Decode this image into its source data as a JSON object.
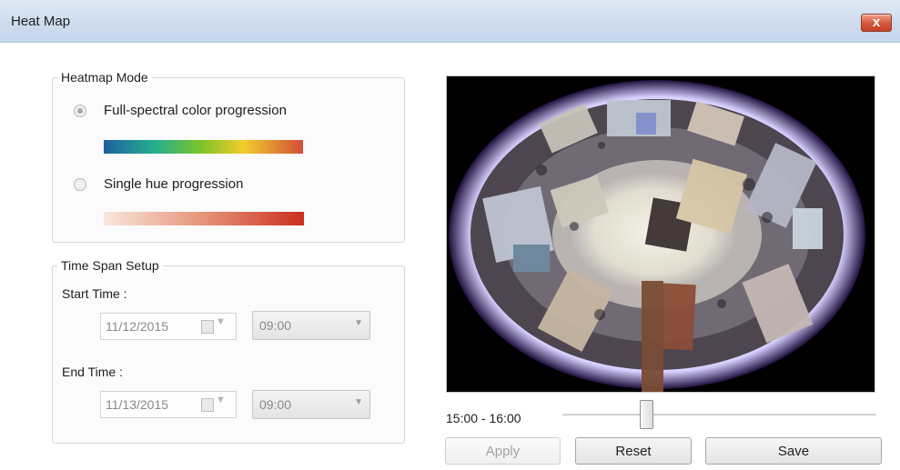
{
  "window": {
    "title": "Heat Map",
    "close_glyph": "x",
    "close_icon": "close-icon"
  },
  "heatmap_mode": {
    "title": "Heatmap Mode",
    "options": [
      {
        "label": "Full-spectral color progression",
        "selected": true,
        "gradient": [
          "#1e5fa0",
          "#25b08d",
          "#79c32a",
          "#f2cd2b",
          "#d24e37"
        ]
      },
      {
        "label": "Single hue progression",
        "selected": false,
        "gradient": [
          "#f9e7dd",
          "#e58f75",
          "#ca2f1f"
        ]
      }
    ]
  },
  "time_span": {
    "title": "Time Span Setup",
    "start_label": "Start Time :",
    "start_date": "11/12/2015",
    "start_time": "09:00",
    "end_label": "End Time :",
    "end_date": "11/13/2015",
    "end_time": "09:00",
    "calendar_icon": "calendar-icon",
    "dropdown_icon": "chevron-down-icon"
  },
  "preview": {
    "icon": "fisheye-camera-view"
  },
  "timeline": {
    "range": "15:00 - 16:00"
  },
  "buttons": {
    "apply": "Apply",
    "reset": "Reset",
    "save": "Save"
  }
}
